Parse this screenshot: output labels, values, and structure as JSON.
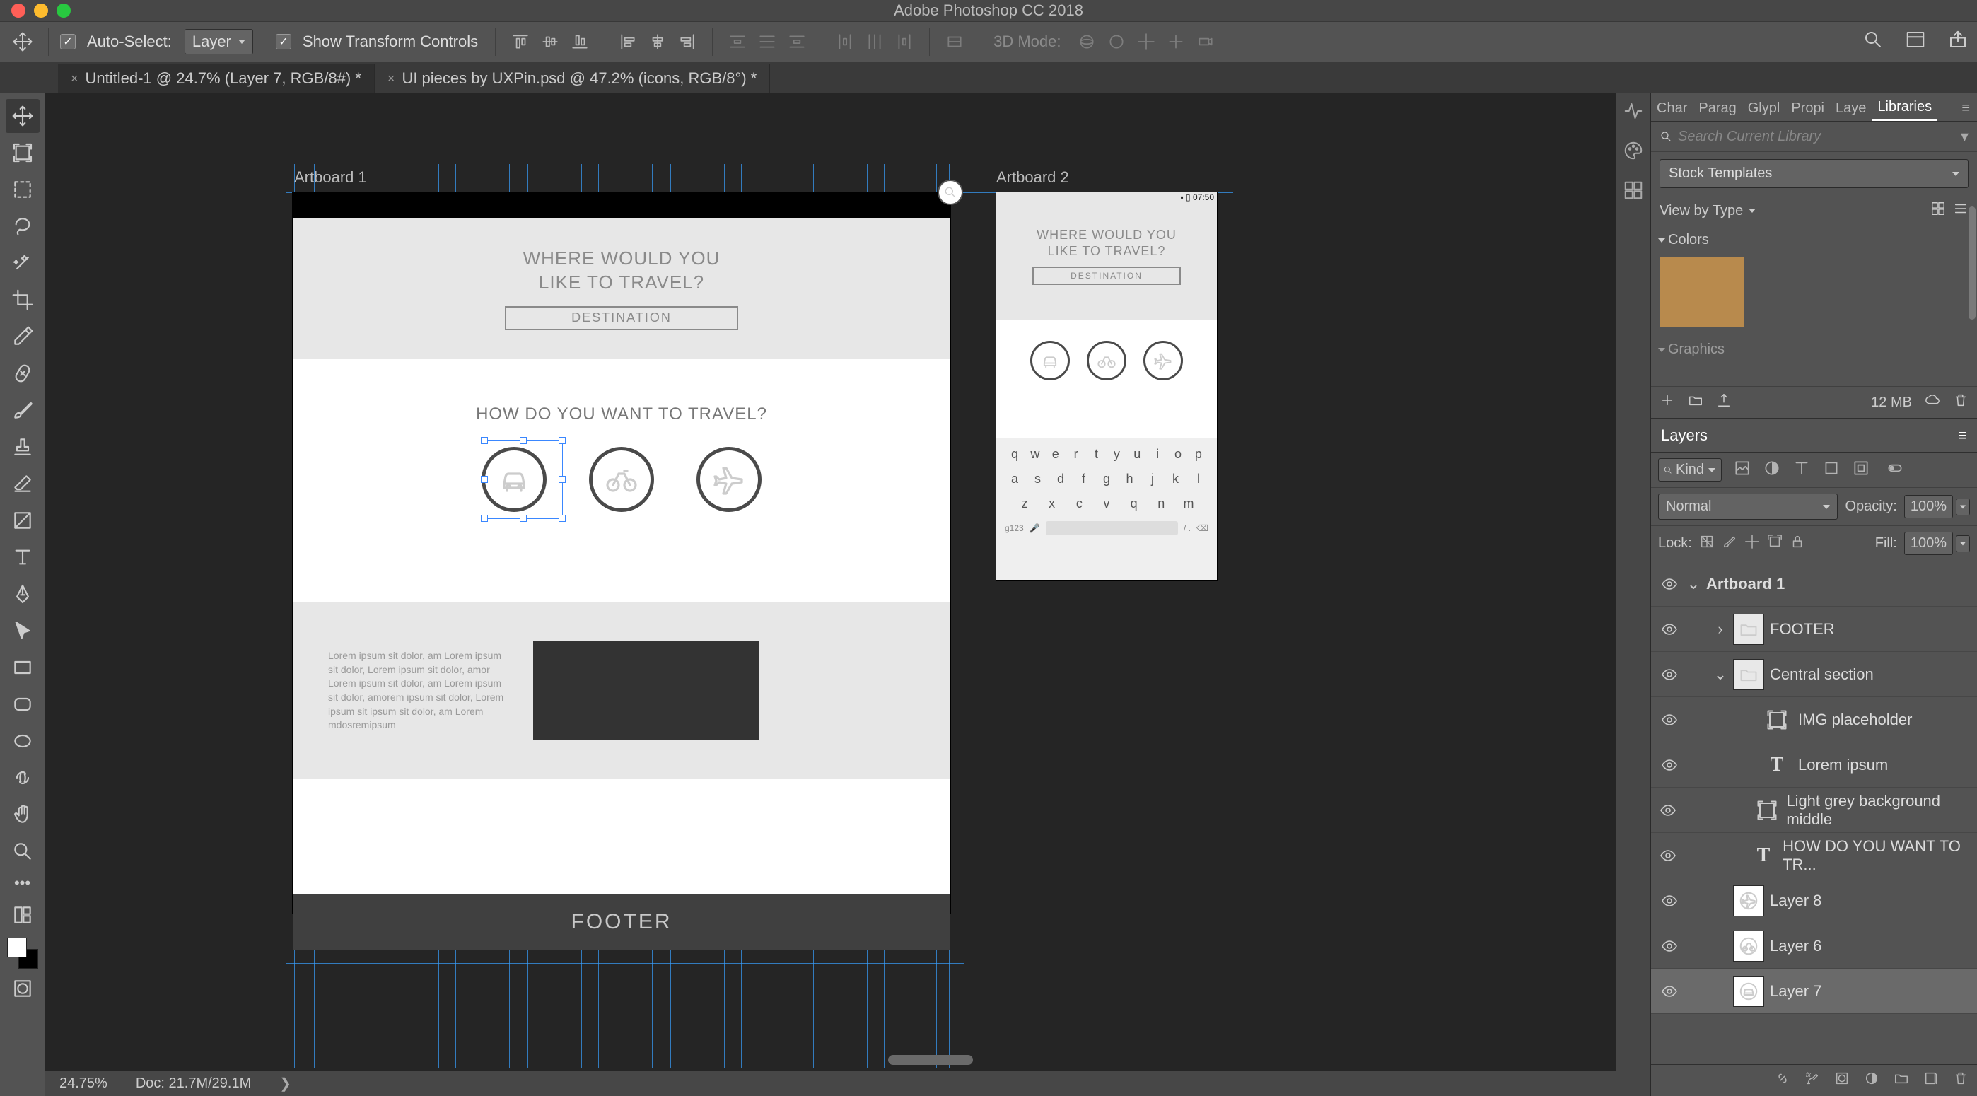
{
  "app": {
    "title": "Adobe Photoshop CC 2018"
  },
  "optionsBar": {
    "autoSelect": {
      "checked": true,
      "label": "Auto-Select:"
    },
    "autoSelectTarget": "Layer",
    "showTransform": {
      "checked": true,
      "label": "Show Transform Controls"
    },
    "mode3dLabel": "3D Mode:"
  },
  "docTabs": [
    {
      "label": "Untitled-1 @ 24.7% (Layer 7, RGB/8#) *",
      "active": true
    },
    {
      "label": "UI pieces by UXPin.psd @ 47.2% (icons, RGB/8°) *",
      "active": false
    }
  ],
  "canvas": {
    "artboard1": {
      "label": "Artboard 1",
      "headline1": "WHERE WOULD YOU",
      "headline2": "LIKE TO TRAVEL?",
      "destination": "DESTINATION",
      "howTitle": "HOW DO YOU WANT TO TRAVEL?",
      "lorem": "Lorem ipsum sit dolor, am Lorem ipsum sit dolor, Lorem ipsum sit dolor, amor Lorem ipsum sit dolor, am Lorem ipsum sit dolor, amorem ipsum sit dolor, Lorem ipsum sit ipsum sit dolor, am Lorem mdosremipsum",
      "footer": "FOOTER"
    },
    "artboard2": {
      "label": "Artboard 2",
      "statusTime": "07:50",
      "headline1": "WHERE WOULD YOU",
      "headline2": "LIKE TO TRAVEL?",
      "destination": "DESTINATION",
      "kbd": {
        "r1": [
          "q",
          "w",
          "e",
          "r",
          "t",
          "y",
          "u",
          "i",
          "o",
          "p"
        ],
        "r2": [
          "a",
          "s",
          "d",
          "f",
          "g",
          "h",
          "j",
          "k",
          "l"
        ],
        "r3": [
          "z",
          "x",
          "c",
          "v",
          "q",
          "n",
          "m"
        ],
        "bottomLeft": "g123",
        "bottomRight": "/  ."
      }
    }
  },
  "panelTabs": {
    "items": [
      "Char",
      "Parag",
      "Glypl",
      "Propi",
      "Laye",
      "Libraries"
    ],
    "active": "Libraries"
  },
  "libraries": {
    "searchPlaceholder": "Search Current Library",
    "selector": "Stock Templates",
    "viewBy": "View by Type",
    "colorsHeader": "Colors",
    "graphicsHeader": "Graphics",
    "swatchHex": "#b88a4d",
    "storage": "12 MB"
  },
  "layers": {
    "title": "Layers",
    "filterKind": "Kind",
    "blend": "Normal",
    "opacityLabel": "Opacity:",
    "opacity": "100%",
    "lockLabel": "Lock:",
    "fillLabel": "Fill:",
    "fill": "100%",
    "items": [
      {
        "name": "Artboard 1",
        "type": "artboard"
      },
      {
        "name": "FOOTER",
        "type": "folder-closed",
        "indent": 1
      },
      {
        "name": "Central section",
        "type": "folder-open",
        "indent": 1
      },
      {
        "name": "IMG placeholder",
        "type": "frame",
        "indent": 2
      },
      {
        "name": "Lorem ipsum",
        "type": "text",
        "indent": 2
      },
      {
        "name": "Light grey background middle",
        "type": "frame",
        "indent": 2
      },
      {
        "name": "HOW DO YOU WANT TO TR...",
        "type": "text",
        "indent": 2
      },
      {
        "name": "Layer 8",
        "type": "img-plane",
        "indent": 1
      },
      {
        "name": "Layer 6",
        "type": "img-bike",
        "indent": 1
      },
      {
        "name": "Layer 7",
        "type": "img-car",
        "indent": 1,
        "selected": true
      }
    ]
  },
  "status": {
    "zoom": "24.75%",
    "doc": "Doc: 21.7M/29.1M"
  }
}
